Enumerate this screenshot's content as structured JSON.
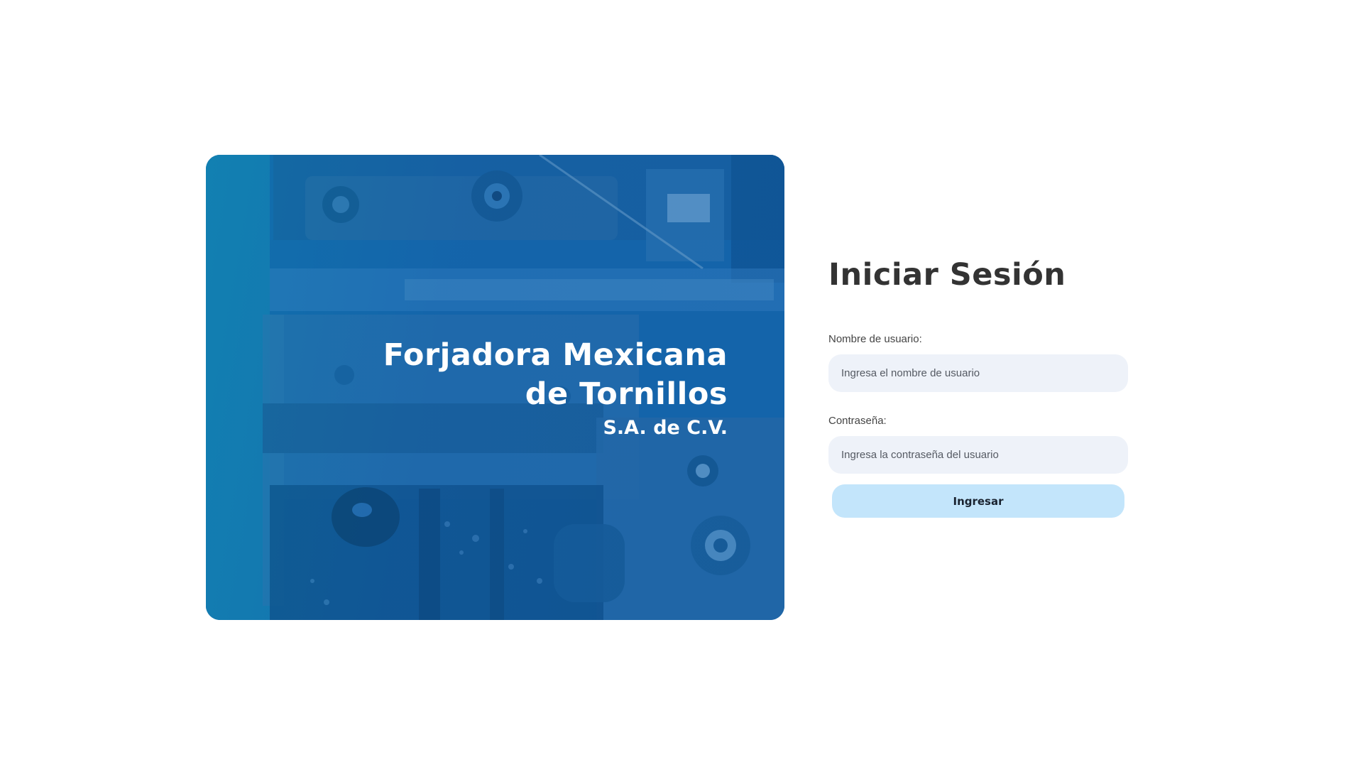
{
  "hero": {
    "title": "Forjadora Mexicana de Tornillos",
    "subtitle": "S.A. de C.V."
  },
  "login": {
    "title": "Iniciar Sesión",
    "username": {
      "label": "Nombre de usuario:",
      "placeholder": "Ingresa el nombre de usuario",
      "value": ""
    },
    "password": {
      "label": "Contraseña:",
      "placeholder": "Ingresa la contraseña del usuario",
      "value": ""
    },
    "submit_label": "Ingresar"
  },
  "colors": {
    "hero_blue": "#1565a8",
    "input_bg": "#eef2f9",
    "button_bg": "#c3e5fb",
    "heading": "#333333"
  }
}
